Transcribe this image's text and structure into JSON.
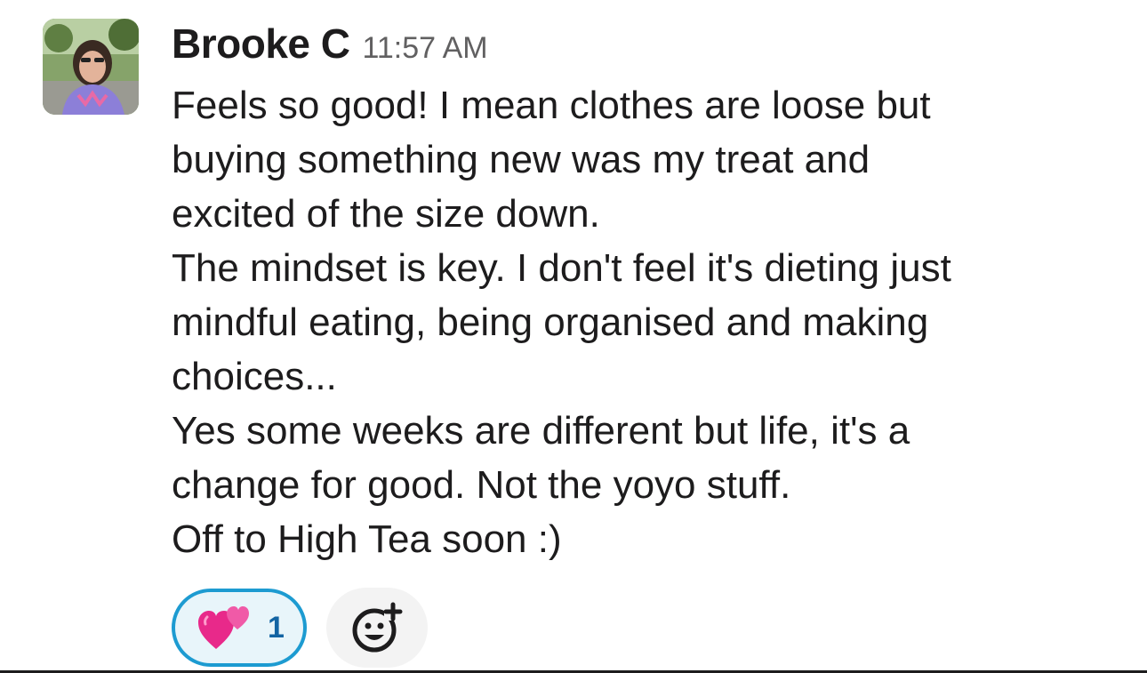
{
  "message": {
    "author": "Brooke C",
    "timestamp": "11:57 AM",
    "avatar_icon": "user-photo-avatar",
    "lines": [
      "Feels so good! I mean clothes are loose but",
      "buying something new was my treat and",
      "excited of the size down.",
      "The mindset is key. I don't feel it's dieting just",
      "mindful eating, being organised and making",
      "choices...",
      "Yes some weeks are different but life, it's a",
      "change for good. Not the yoyo stuff.",
      "Off to High Tea soon :)"
    ]
  },
  "reactions": [
    {
      "emoji": "two-hearts-emoji",
      "count": "1",
      "reacted_by_me": true
    }
  ],
  "add_reaction": {
    "icon": "add-reaction-icon"
  },
  "colors": {
    "text": "#1d1c1d",
    "timestamp": "#616061",
    "reaction_border": "#1d9bd1",
    "reaction_bg": "#e8f5fa",
    "reaction_count": "#1264a3",
    "add_reaction_bg": "#f3f3f3",
    "heart": "#e8298a"
  }
}
